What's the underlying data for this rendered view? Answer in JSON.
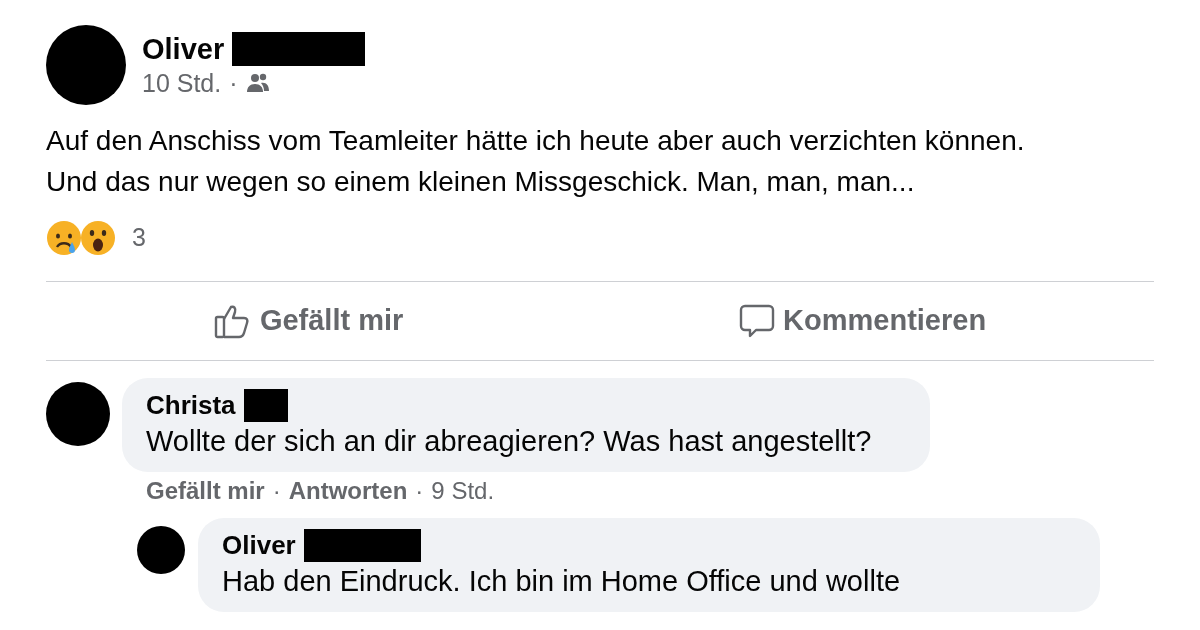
{
  "post": {
    "author": "Oliver",
    "surname_redacted": true,
    "time": "10 Std.",
    "separator": "·",
    "shared_with_friends": true,
    "text": [
      "Auf den Anschiss vom Teamleiter hätte ich heute aber auch verzichten können.",
      "Und das nur wegen so einem kleinen Missgeschick. Man, man, man..."
    ],
    "reactions": [
      {
        "kind": "sad"
      },
      {
        "kind": "wow"
      }
    ],
    "reaction_count": "3",
    "actions": [
      {
        "kind": "like",
        "label": "Gefällt mir"
      },
      {
        "kind": "comment",
        "label": "Kommentieren"
      }
    ]
  },
  "comments": [
    {
      "author": "Christa",
      "surname_redacted": true,
      "text": "Wollte der sich an dir abreagieren? Was hast angestellt?",
      "actions": [
        "Gefällt mir",
        "Antworten"
      ],
      "separators": [
        "·",
        "·"
      ],
      "time": "9 Std.",
      "replies": [
        {
          "author": "Oliver",
          "surname_redacted": true,
          "text": "Hab den Eindruck. Ich bin im Home Office und wollte"
        }
      ]
    }
  ]
}
